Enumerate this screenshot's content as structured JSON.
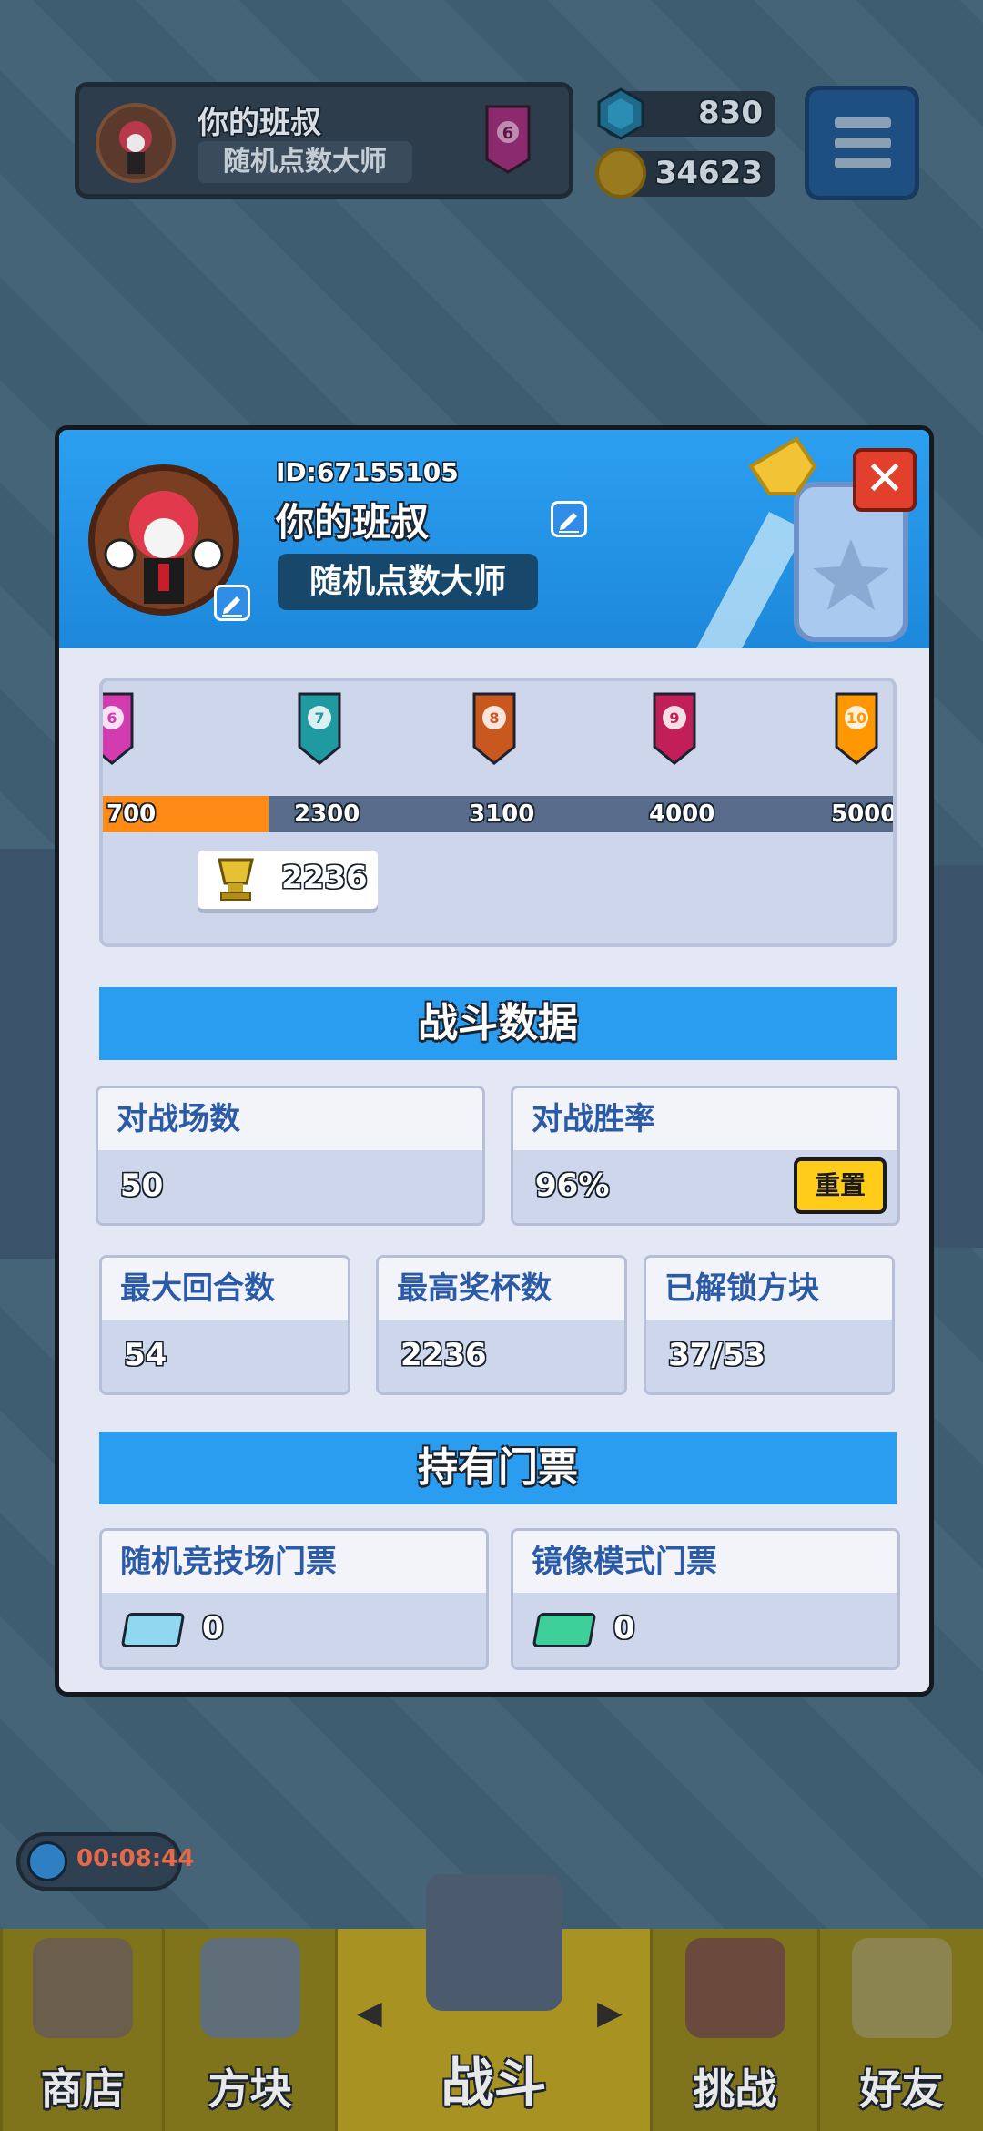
{
  "topbar": {
    "player_name": "你的班叔",
    "player_title": "随机点数大师",
    "rank_level": "6",
    "gems": "830",
    "coins": "34623"
  },
  "modal": {
    "id_text": "ID:67155105",
    "name": "你的班叔",
    "title": "随机点数大师",
    "close_label": "✕",
    "rank_track": {
      "progress_fraction": 0.21,
      "ranks": [
        {
          "level": "6",
          "threshold": "700",
          "color": "#d43bb0"
        },
        {
          "level": "7",
          "threshold": "2300",
          "color": "#1e9aa0"
        },
        {
          "level": "8",
          "threshold": "3100",
          "color": "#c8581e"
        },
        {
          "level": "9",
          "threshold": "4000",
          "color": "#c21f59"
        },
        {
          "level": "10",
          "threshold": "5000",
          "color": "#ff9800"
        }
      ],
      "current_trophies": "2236"
    },
    "battle_section": {
      "title": "战斗数据",
      "matches_label": "对战场数",
      "matches_value": "50",
      "winrate_label": "对战胜率",
      "winrate_value": "96%",
      "reset_label": "重置",
      "max_rounds_label": "最大回合数",
      "max_rounds_value": "54",
      "max_trophies_label": "最高奖杯数",
      "max_trophies_value": "2236",
      "unlocked_label": "已解锁方块",
      "unlocked_value": "37/53"
    },
    "ticket_section": {
      "title": "持有门票",
      "arena_label": "随机竞技场门票",
      "arena_value": "0",
      "mirror_label": "镜像模式门票",
      "mirror_value": "0"
    }
  },
  "timer": "00:08:44",
  "nav": {
    "shop": "商店",
    "blocks": "方块",
    "battle": "战斗",
    "challenge": "挑战",
    "friends": "好友"
  },
  "colors": {
    "accent_blue": "#2b9df0",
    "progress_orange": "#ff8a16",
    "reset_yellow": "#ffcc1a",
    "close_red": "#e2402d"
  }
}
